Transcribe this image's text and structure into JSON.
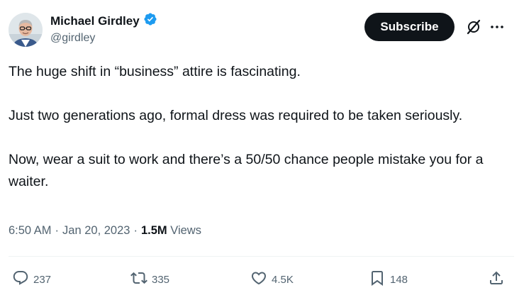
{
  "author": {
    "name": "Michael Girdley",
    "handle": "@girdley"
  },
  "buttons": {
    "subscribe": "Subscribe"
  },
  "icons": {
    "verified": "verified-badge-icon",
    "grok": "grok-icon",
    "more": "more-options-icon",
    "reply": "reply-icon",
    "retweet": "retweet-icon",
    "like": "like-icon",
    "bookmark": "bookmark-icon",
    "share": "share-icon"
  },
  "tweet": {
    "paragraphs": [
      "The huge shift in “business” attire is fascinating.",
      "Just two generations ago, formal dress was required to be taken seriously.",
      "Now, wear a suit to work and there’s a 50/50 chance people mistake you for a waiter."
    ],
    "time": "6:50 AM",
    "separator": "·",
    "date": "Jan 20, 2023",
    "views_count": "1.5M",
    "views_label": "Views"
  },
  "stats": {
    "replies": "237",
    "retweets": "335",
    "likes": "4.5K",
    "bookmarks": "148"
  },
  "colors": {
    "verified": "#1d9bf0",
    "text": "#0f1419",
    "secondary": "#536471",
    "button_bg": "#0f1419"
  }
}
